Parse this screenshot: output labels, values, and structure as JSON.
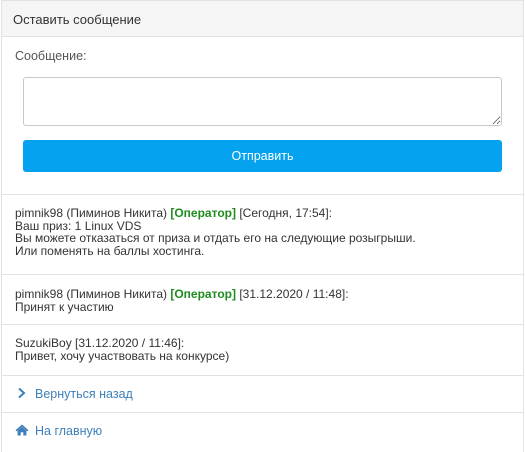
{
  "header": {
    "title": "Оставить сообщение"
  },
  "form": {
    "label": "Сообщение:",
    "textarea_value": "",
    "send_label": "Отправить"
  },
  "messages": [
    {
      "author": "pimnik98 (Пиминов Никита)",
      "role": "[Оператор]",
      "time": "[Сегодня, 17:54]:",
      "lines": [
        "Ваш приз: 1 Linux VDS",
        "Вы можете отказаться от приза и отдать его на следующие розыгрыши.",
        "Или поменять на баллы хостинга."
      ]
    },
    {
      "author": "pimnik98 (Пиминов Никита)",
      "role": "[Оператор]",
      "time": "[31.12.2020 / 11:48]:",
      "lines": [
        "Принят к участию"
      ]
    },
    {
      "author": "SuzukiBoy",
      "time": "[31.12.2020 / 11:46]:",
      "lines": [
        "Привет, хочу участвовать на конкурсе)"
      ]
    }
  ],
  "nav": {
    "back_label": "Вернуться назад",
    "home_label": "На главную"
  },
  "colors": {
    "accent": "#05a2f0",
    "operator": "#1e8c1e",
    "link": "#3d7fb8"
  },
  "icons": {
    "back": "chevron-right-icon",
    "home": "home-icon"
  }
}
